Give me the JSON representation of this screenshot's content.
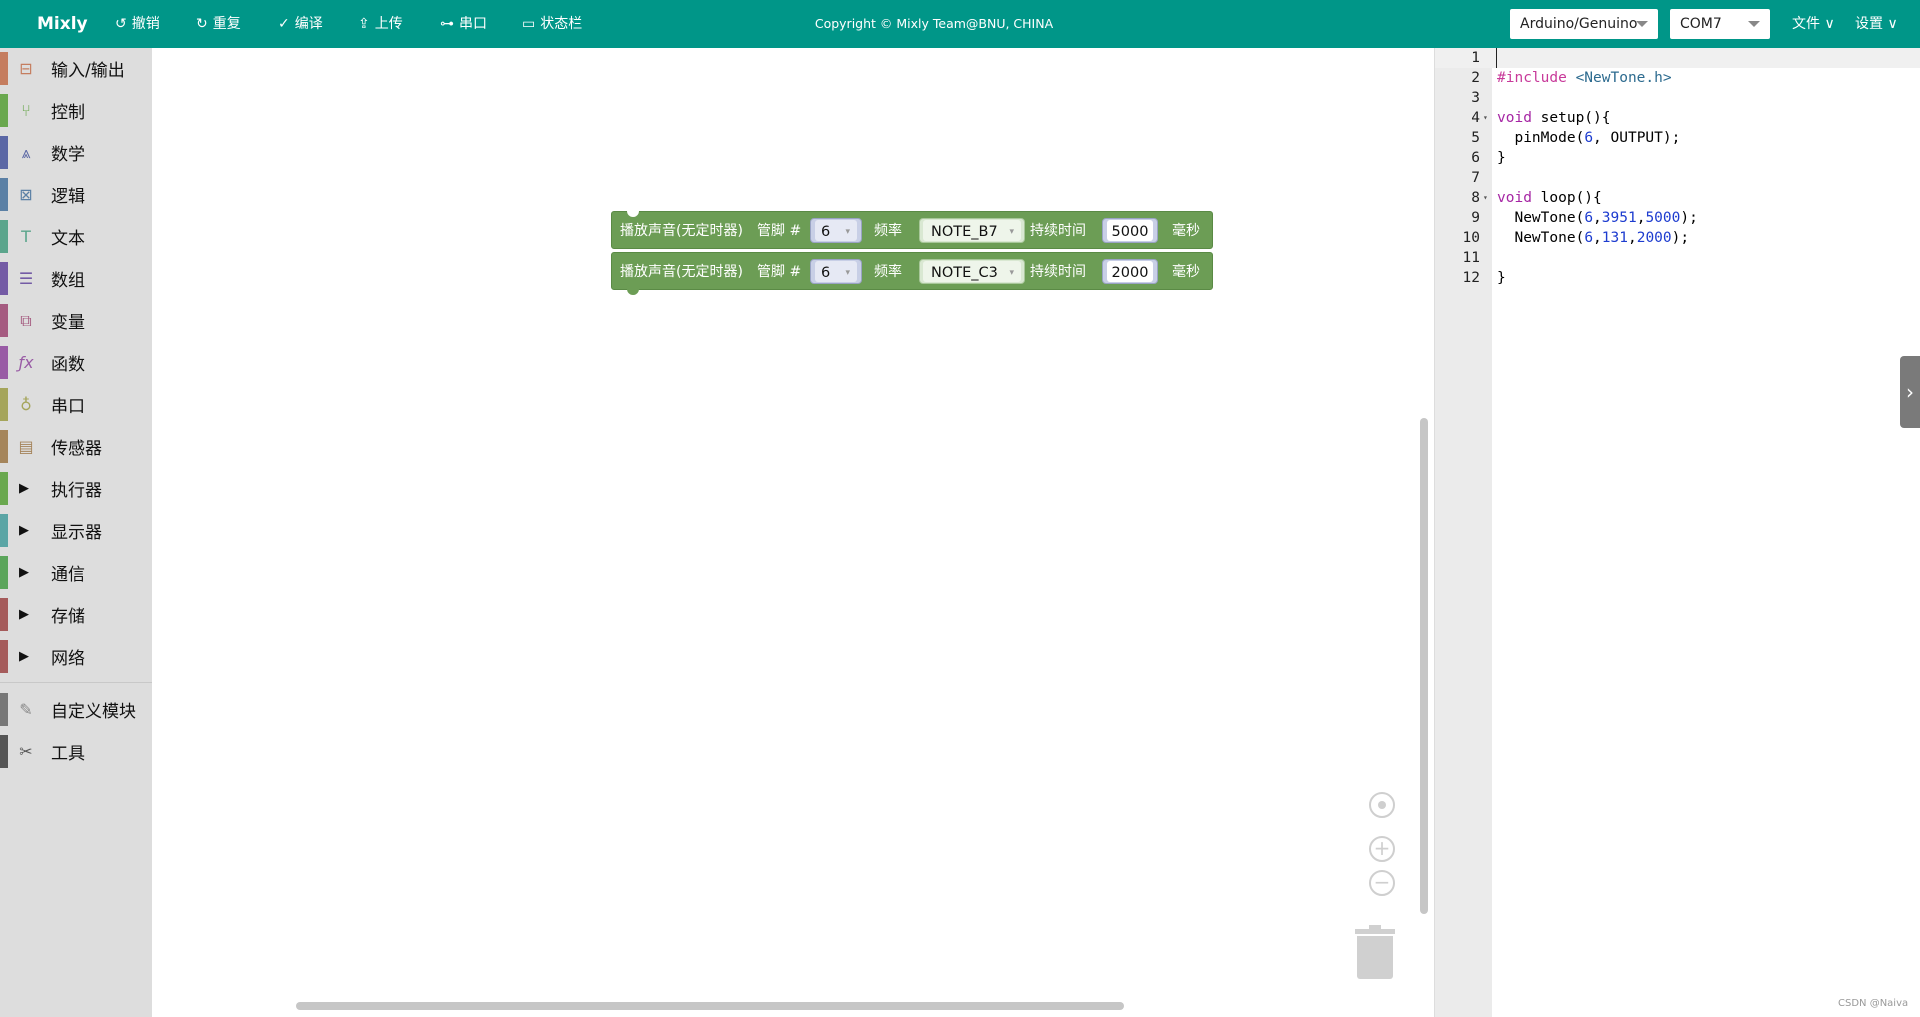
{
  "topbar": {
    "brand": "Mixly",
    "undo": "撤销",
    "redo": "重复",
    "compile": "编译",
    "upload": "上传",
    "serial": "串口",
    "statusbar": "状态栏",
    "copyright": "Copyright © Mixly Team@BNU, CHINA",
    "board": "Arduino/Genuino",
    "port": "COM7",
    "file_menu": "文件",
    "settings_menu": "设置",
    "accent_color": "#009688"
  },
  "toolbox": {
    "items": [
      {
        "label": "输入/输出",
        "color": "#c57d5f",
        "icon": "io-icon"
      },
      {
        "label": "控制",
        "color": "#6aa84f",
        "icon": "control-icon"
      },
      {
        "label": "数学",
        "color": "#5b67a5",
        "icon": "math-icon"
      },
      {
        "label": "逻辑",
        "color": "#5b80a5",
        "icon": "logic-icon"
      },
      {
        "label": "文本",
        "color": "#5ba58c",
        "icon": "text-icon"
      },
      {
        "label": "数组",
        "color": "#745ba5",
        "icon": "array-icon"
      },
      {
        "label": "变量",
        "color": "#a55b80",
        "icon": "variable-icon"
      },
      {
        "label": "函数",
        "color": "#995ba5",
        "icon": "function-icon"
      },
      {
        "label": "串口",
        "color": "#a5a55b",
        "icon": "serial-icon"
      },
      {
        "label": "传感器",
        "color": "#a5855b",
        "icon": "sensor-icon"
      },
      {
        "label": "执行器",
        "color": "#6aa84f"
      },
      {
        "label": "显示器",
        "color": "#5ba5a5"
      },
      {
        "label": "通信",
        "color": "#5ba55b"
      },
      {
        "label": "存储",
        "color": "#a55b5b"
      },
      {
        "label": "网络",
        "color": "#a55b5b"
      },
      {
        "label": "自定义模块",
        "color": "#777777",
        "icon": "custom-icon"
      },
      {
        "label": "工具",
        "color": "#555555",
        "icon": "tools-icon"
      }
    ]
  },
  "blocks": [
    {
      "label": "播放声音(无定时器)",
      "pin_label": "管脚 #",
      "pin": "6",
      "freq_label": "频率",
      "note": "NOTE_B7",
      "dur_label": "持续时间",
      "duration": "5000",
      "unit": "毫秒"
    },
    {
      "label": "播放声音(无定时器)",
      "pin_label": "管脚 #",
      "pin": "6",
      "freq_label": "频率",
      "note": "NOTE_C3",
      "dur_label": "持续时间",
      "duration": "2000",
      "unit": "毫秒"
    }
  ],
  "code": {
    "line_numbers": [
      "1",
      "2",
      "3",
      "4",
      "5",
      "6",
      "7",
      "8",
      "9",
      "10",
      "11",
      "12"
    ]
  },
  "watermark": "CSDN @Naiva"
}
